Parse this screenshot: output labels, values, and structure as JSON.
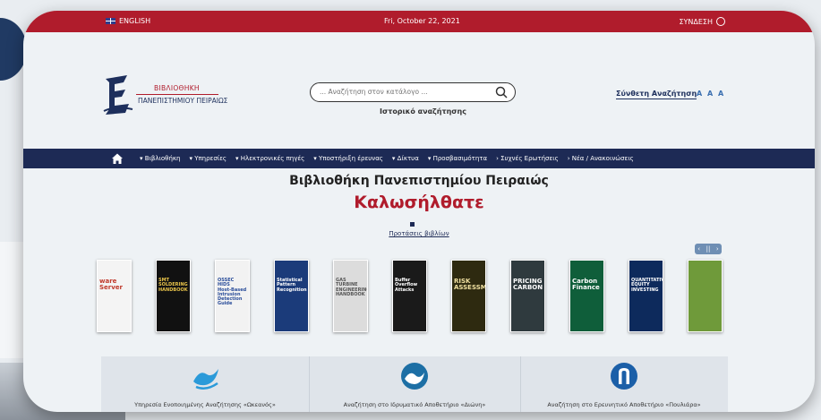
{
  "topbar": {
    "language": "ENGLISH",
    "date": "Fri, October 22, 2021",
    "login": "ΣΥΝΔΕΣΗ"
  },
  "logo": {
    "line1": "ΒΙΒΛΙΟΘΗΚΗ",
    "line2": "ΠΑΝΕΠΙΣΤΗΜΙΟΥ ΠΕΙΡΑΙΩΣ"
  },
  "search": {
    "placeholder": "... Αναζήτηση στον κατάλογο ...",
    "history_link": "Ιστορικό αναζήτησης"
  },
  "advanced_search": "Σύνθετη Αναζήτηση",
  "font_sizes": [
    "A",
    "A",
    "A"
  ],
  "nav": {
    "items": [
      "▾ Βιβλιοθήκη",
      "▾ Υπηρεσίες",
      "▾ Ηλεκτρονικές πηγές",
      "▾ Υποστήριξη έρευνας",
      "▾ Δίκτυα",
      "▾ Προσβασιμότητα",
      "› Συχνές Ερωτήσεις",
      "› Νέα / Ανακοινώσεις"
    ]
  },
  "main": {
    "title": "Βιβλιοθήκη Πανεπιστημίου Πειραιώς",
    "welcome": "Καλωσήλθατε",
    "suggestions_link": "Προτάσεις βιβλίων"
  },
  "carousel": {
    "controls": [
      "‹",
      "||",
      "›"
    ],
    "books": [
      {
        "title": "ware\nServer",
        "bg": "#f4f4f4",
        "fg": "#c0392b"
      },
      {
        "title": "SMT\nSOLDERING\nHANDBOOK",
        "bg": "#111111",
        "fg": "#e8c34a"
      },
      {
        "title": "OSSEC HIDS\nHost-Based Intrusion\nDetection Guide",
        "bg": "#f2f2f2",
        "fg": "#2a4d9a"
      },
      {
        "title": "Statistical\nPattern\nRecognition",
        "bg": "#1b3b7a",
        "fg": "#ffffff"
      },
      {
        "title": "GAS TURBINE\nENGINEERING\nHANDBOOK",
        "bg": "#dcdcdc",
        "fg": "#555555"
      },
      {
        "title": "Buffer\nOverflow\nAttacks",
        "bg": "#1a1a1a",
        "fg": "#ffffff"
      },
      {
        "title": "RISK\nASSESSMENT",
        "bg": "#2e2a10",
        "fg": "#f0e0a0"
      },
      {
        "title": "PRICING\nCARBON",
        "bg": "#2f3a3e",
        "fg": "#ffffff"
      },
      {
        "title": "Carbon\nFinance",
        "bg": "#0f5e3a",
        "fg": "#ffffff"
      },
      {
        "title": "QUANTITATIVE\nEQUITY\nINVESTING",
        "bg": "#0d2a5c",
        "fg": "#ffffff"
      },
      {
        "title": "",
        "bg": "#6f9a3a",
        "fg": "#ffffff"
      }
    ]
  },
  "services": [
    {
      "label": "Υπηρεσία Ενοποιημένης Αναζήτησης «Ωκεανός»",
      "icon": "ocean-wave-icon"
    },
    {
      "label": "Αναζήτηση στο Ιδρυματικό Αποθετήριο «Διώνη»",
      "icon": "dione-icon"
    },
    {
      "label": "Αναζήτηση στο Ερευνητικό Αποθετήριο «Πουλιάρα»",
      "icon": "repository-icon"
    }
  ],
  "colors": {
    "brand_red": "#b01c2c",
    "nav_blue": "#1d2a55"
  }
}
